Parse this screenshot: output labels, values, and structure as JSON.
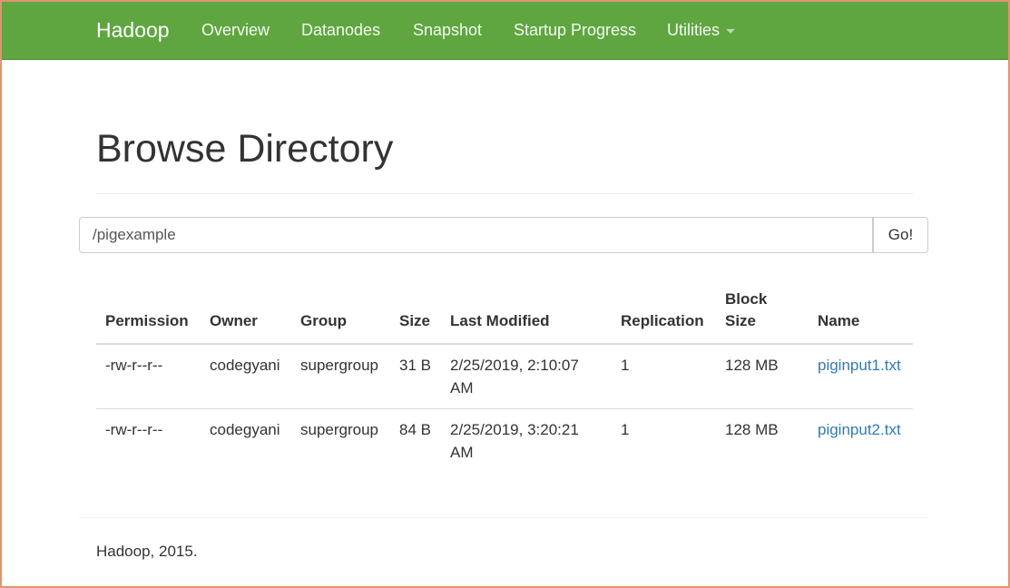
{
  "navbar": {
    "brand": "Hadoop",
    "items": [
      {
        "label": "Overview"
      },
      {
        "label": "Datanodes"
      },
      {
        "label": "Snapshot"
      },
      {
        "label": "Startup Progress"
      },
      {
        "label": "Utilities"
      }
    ]
  },
  "page": {
    "title": "Browse Directory"
  },
  "path_bar": {
    "value": "/pigexample",
    "go_label": "Go!"
  },
  "table": {
    "headers": [
      "Permission",
      "Owner",
      "Group",
      "Size",
      "Last Modified",
      "Replication",
      "Block Size",
      "Name"
    ],
    "rows": [
      {
        "permission": "-rw-r--r--",
        "owner": "codegyani",
        "group": "supergroup",
        "size": "31 B",
        "last_modified": "2/25/2019, 2:10:07 AM",
        "replication": "1",
        "block_size": "128 MB",
        "name": "piginput1.txt"
      },
      {
        "permission": "-rw-r--r--",
        "owner": "codegyani",
        "group": "supergroup",
        "size": "84 B",
        "last_modified": "2/25/2019, 3:20:21 AM",
        "replication": "1",
        "block_size": "128 MB",
        "name": "piginput2.txt"
      }
    ]
  },
  "footer": {
    "text": "Hadoop, 2015."
  },
  "colors": {
    "navbar_bg": "#5fa641",
    "link": "#337ab7"
  }
}
